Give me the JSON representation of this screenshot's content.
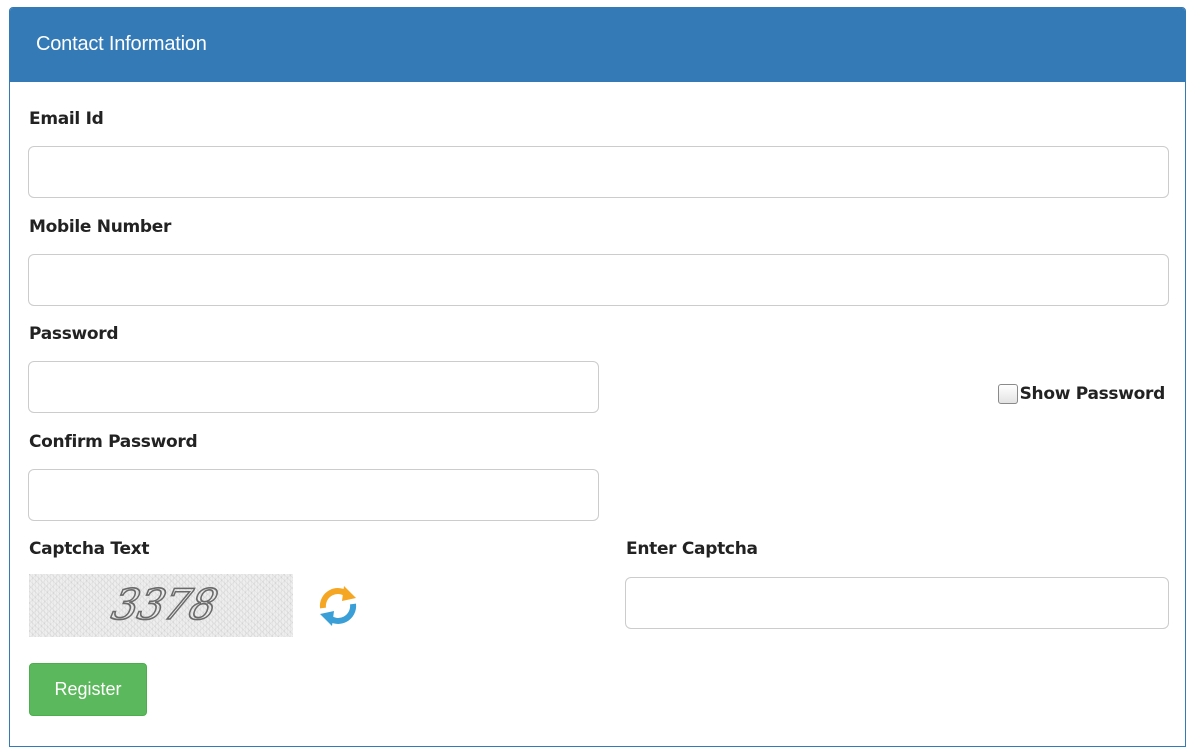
{
  "panel": {
    "title": "Contact Information",
    "header_color": "#337ab7"
  },
  "form": {
    "email": {
      "label": "Email Id",
      "value": ""
    },
    "mobile": {
      "label": "Mobile Number",
      "value": ""
    },
    "password": {
      "label": "Password",
      "value": ""
    },
    "show_password": {
      "label": "Show Password",
      "checked": false
    },
    "confirm_password": {
      "label": "Confirm Password",
      "value": ""
    },
    "captcha": {
      "label": "Captcha Text",
      "code": "3378",
      "refresh_icon": "refresh-icon",
      "refresh_colors": [
        "#f5a623",
        "#3a9fd6"
      ]
    },
    "enter_captcha": {
      "label": "Enter Captcha",
      "value": ""
    },
    "register": {
      "label": "Register",
      "color": "#5cb85c"
    }
  }
}
